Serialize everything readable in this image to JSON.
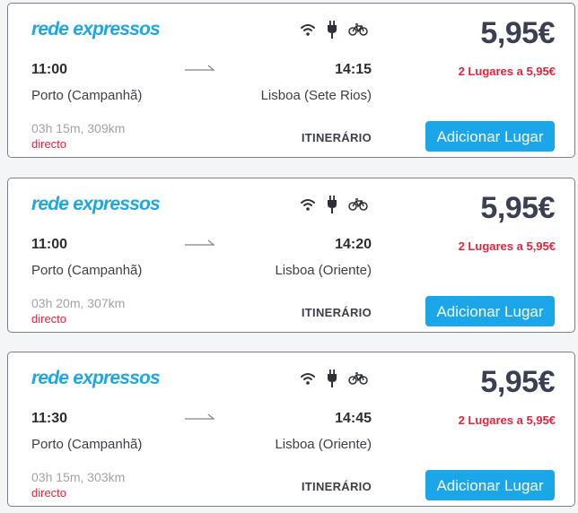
{
  "colors": {
    "brand": "#1ea7e1",
    "price": "#3a3f52",
    "alert": "#e3243b",
    "button": "#1aa6e8"
  },
  "trips": [
    {
      "operator": "rede expressos",
      "amenities": [
        "wifi-icon",
        "power-plug-icon",
        "bicycle-icon"
      ],
      "price": "5,95€",
      "departure_time": "11:00",
      "arrival_time": "14:15",
      "seats_text": "2 Lugares a 5,95€",
      "origin": "Porto (Campanhã)",
      "destination": "Lisboa (Sete Rios)",
      "duration_distance": "03h 15m, 309km",
      "type": "directo",
      "itinerary_label": "ITINERÁRIO",
      "add_button_label": "Adicionar Lugar"
    },
    {
      "operator": "rede expressos",
      "amenities": [
        "wifi-icon",
        "power-plug-icon",
        "bicycle-icon"
      ],
      "price": "5,95€",
      "departure_time": "11:00",
      "arrival_time": "14:20",
      "seats_text": "2 Lugares a 5,95€",
      "origin": "Porto (Campanhã)",
      "destination": "Lisboa (Oriente)",
      "duration_distance": "03h 20m, 307km",
      "type": "directo",
      "itinerary_label": "ITINERÁRIO",
      "add_button_label": "Adicionar Lugar"
    },
    {
      "operator": "rede expressos",
      "amenities": [
        "wifi-icon",
        "power-plug-icon",
        "bicycle-icon"
      ],
      "price": "5,95€",
      "departure_time": "11:30",
      "arrival_time": "14:45",
      "seats_text": "2 Lugares a 5,95€",
      "origin": "Porto (Campanhã)",
      "destination": "Lisboa (Oriente)",
      "duration_distance": "03h 15m, 303km",
      "type": "directo",
      "itinerary_label": "ITINERÁRIO",
      "add_button_label": "Adicionar Lugar"
    }
  ]
}
